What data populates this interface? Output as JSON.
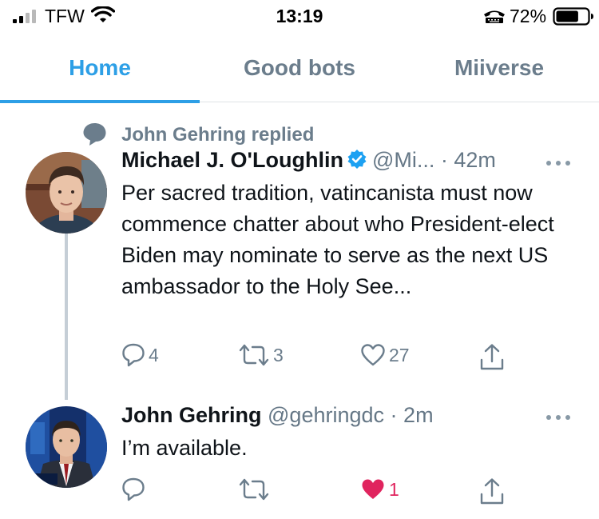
{
  "status_bar": {
    "carrier": "TFW",
    "time": "13:19",
    "battery_percent": "72%",
    "battery_level": 0.72
  },
  "tabs": [
    {
      "label": "Home",
      "active": true
    },
    {
      "label": "Good bots",
      "active": false
    },
    {
      "label": "Miiverse",
      "active": false
    }
  ],
  "timeline": {
    "context": {
      "icon": "speech-bubble-icon",
      "text": "John Gehring replied"
    },
    "tweets": [
      {
        "name": "Michael J. O'Loughlin",
        "verified": true,
        "handle": "@Mi...",
        "separator": "·",
        "time": "42m",
        "text": "Per sacred tradition, vatincanista must now commence chatter about who President-elect Biden may nominate to serve as the next US ambassador to the Holy See...",
        "actions": {
          "replies": "4",
          "retweets": "3",
          "likes": "27",
          "liked": false
        }
      },
      {
        "name": "John Gehring",
        "verified": false,
        "handle": "@gehringdc",
        "separator": "·",
        "time": "2m",
        "text": "I’m available.",
        "actions": {
          "replies": "",
          "retweets": "",
          "likes": "1",
          "liked": true
        }
      }
    ]
  },
  "colors": {
    "accent": "#2d9fe6",
    "secondary_text": "#6b7d8c",
    "like_red": "#e0245e",
    "verified_blue": "#1da1f2"
  }
}
